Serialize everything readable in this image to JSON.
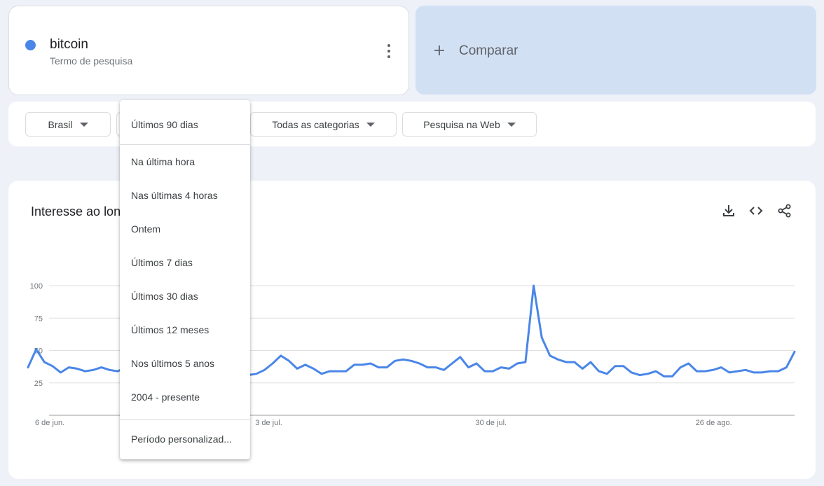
{
  "term": {
    "name": "bitcoin",
    "subtitle": "Termo de pesquisa",
    "color": "#4a86e8",
    "more_icon": "more-vert-icon"
  },
  "compare": {
    "label": "Comparar",
    "icon": "plus-icon"
  },
  "filters": {
    "region": "Brasil",
    "category": "Todas as categorias",
    "search_type": "Pesquisa na Web"
  },
  "time_menu": {
    "selected": "Últimos 90 dias",
    "options": [
      "Na última hora",
      "Nas últimas 4 horas",
      "Ontem",
      "Últimos 7 dias",
      "Últimos 30 dias",
      "Últimos 12 meses",
      "Nos últimos 5 anos",
      "2004 - presente"
    ],
    "custom": "Período personalizad..."
  },
  "chart_panel": {
    "title": "Interesse ao longo do tempo",
    "icons": [
      "download-icon",
      "embed-code-icon",
      "share-icon"
    ]
  },
  "chart_data": {
    "type": "line",
    "ylim": [
      0,
      100
    ],
    "yticks": [
      25,
      50,
      75,
      100
    ],
    "xticks": [
      "6 de jun.",
      "3 de jul.",
      "30 de jul.",
      "26 de ago."
    ],
    "xtick_index": [
      0,
      27,
      54,
      81
    ],
    "grid": true,
    "series": [
      {
        "color": "#4a86e8",
        "values": [
          37,
          51,
          41,
          38,
          33,
          37,
          36,
          34,
          35,
          37,
          35,
          34,
          37,
          36,
          35,
          34,
          34,
          33,
          32,
          32,
          32,
          31,
          31,
          31,
          32,
          31,
          31,
          31,
          32,
          35,
          40,
          46,
          42,
          36,
          39,
          36,
          32,
          34,
          34,
          34,
          39,
          39,
          40,
          37,
          37,
          42,
          43,
          42,
          40,
          37,
          37,
          35,
          40,
          45,
          37,
          40,
          34,
          34,
          37,
          36,
          40,
          41,
          100,
          60,
          46,
          43,
          41,
          41,
          36,
          41,
          34,
          32,
          38,
          38,
          33,
          31,
          32,
          34,
          30,
          30,
          37,
          40,
          34,
          34,
          35,
          37,
          33,
          34,
          35,
          33,
          33,
          34,
          34,
          37,
          49
        ]
      }
    ]
  }
}
